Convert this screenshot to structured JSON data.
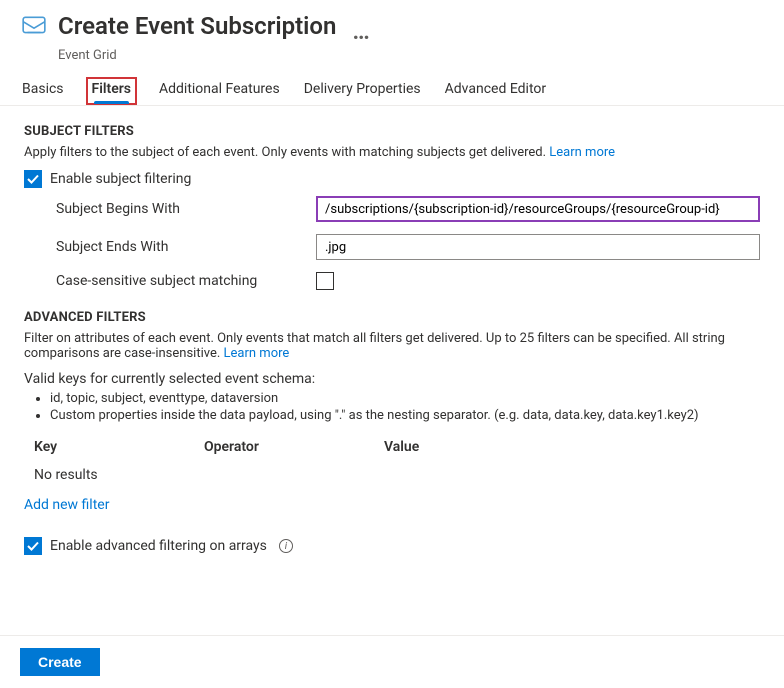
{
  "header": {
    "title": "Create Event Subscription",
    "subtitle": "Event Grid",
    "more_label": "…"
  },
  "tabs": [
    {
      "label": "Basics",
      "selected": false,
      "highlight": false
    },
    {
      "label": "Filters",
      "selected": true,
      "highlight": true
    },
    {
      "label": "Additional Features",
      "selected": false,
      "highlight": false
    },
    {
      "label": "Delivery Properties",
      "selected": false,
      "highlight": false
    },
    {
      "label": "Advanced Editor",
      "selected": false,
      "highlight": false
    }
  ],
  "subject_filters": {
    "title": "SUBJECT FILTERS",
    "description": "Apply filters to the subject of each event. Only events with matching subjects get delivered. ",
    "learn_more": "Learn more",
    "enable_checkbox_label": "Enable subject filtering",
    "enable_checked": true,
    "begins_with_label": "Subject Begins With",
    "begins_with_value": "/subscriptions/{subscription-id}/resourceGroups/{resourceGroup-id}",
    "ends_with_label": "Subject Ends With",
    "ends_with_value": ".jpg",
    "case_sensitive_label": "Case-sensitive subject matching",
    "case_sensitive_checked": false
  },
  "advanced_filters": {
    "title": "ADVANCED FILTERS",
    "description": "Filter on attributes of each event. Only events that match all filters get delivered. Up to 25 filters can be specified. All string comparisons are case-insensitive. ",
    "learn_more": "Learn more",
    "valid_keys_heading": "Valid keys for currently selected event schema:",
    "valid_keys_items": [
      "id, topic, subject, eventtype, dataversion",
      "Custom properties inside the data payload, using \".\" as the nesting separator. (e.g. data, data.key, data.key1.key2)"
    ],
    "columns": {
      "key": "Key",
      "operator": "Operator",
      "value": "Value"
    },
    "no_results_label": "No results",
    "add_new_label": "Add new filter",
    "enable_arrays_label": "Enable advanced filtering on arrays",
    "enable_arrays_checked": true
  },
  "footer": {
    "create_label": "Create"
  }
}
